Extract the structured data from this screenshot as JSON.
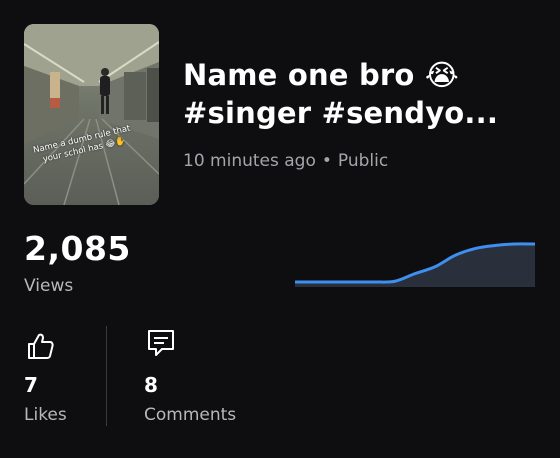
{
  "video": {
    "title_line1": "Name one bro 😭",
    "title_line2": "#singer #sendyo...",
    "posted": "10 minutes ago",
    "separator": "•",
    "visibility": "Public",
    "thumbnail_caption": "Name a dumb rule that your schol has 😂✋"
  },
  "views": {
    "count": "2,085",
    "label": "Views"
  },
  "views_trend": {
    "type": "area",
    "x": [
      0,
      1,
      2,
      3,
      4,
      5,
      6,
      7,
      8,
      9,
      10,
      11,
      12
    ],
    "values": [
      0,
      0,
      0,
      0,
      0,
      0.02,
      0.22,
      0.4,
      0.7,
      0.88,
      0.96,
      1.0,
      1.0
    ],
    "line_color": "#3d8ff0",
    "fill_color": "#2a2f3c"
  },
  "stats": {
    "likes": {
      "value": "7",
      "label": "Likes",
      "icon": "thumbs-up-icon"
    },
    "comments": {
      "value": "8",
      "label": "Comments",
      "icon": "comment-icon"
    }
  }
}
